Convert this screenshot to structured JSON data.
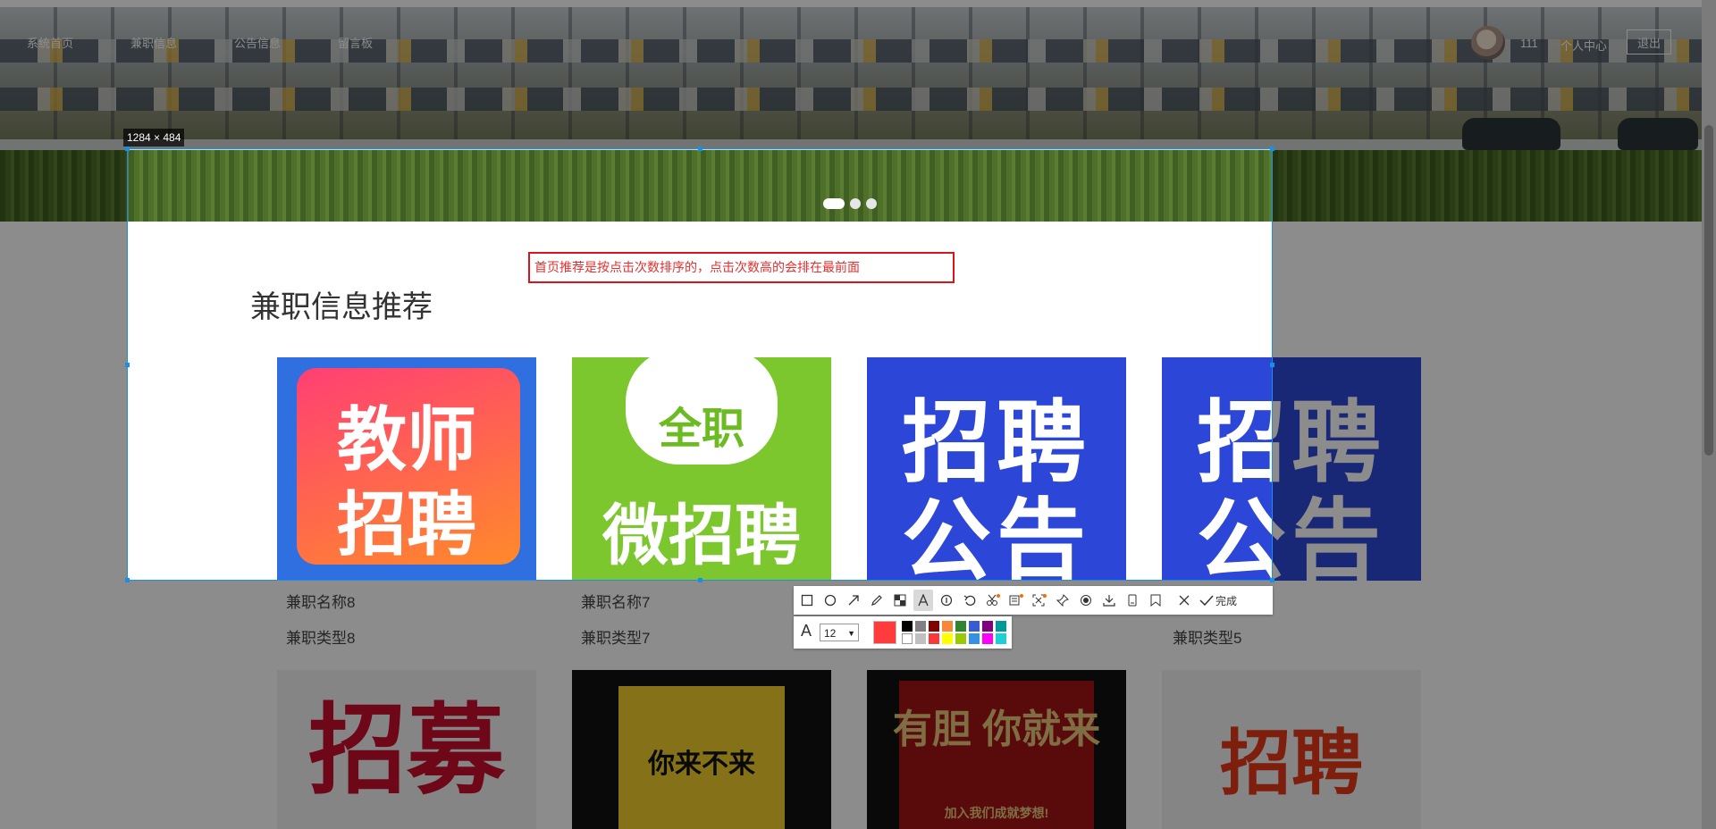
{
  "nav": {
    "items": [
      "系统首页",
      "兼职信息",
      "公告信息",
      "留言板"
    ],
    "user_name": "111",
    "user_center": "个人中心",
    "logout": "退出"
  },
  "carousel": {
    "slide_count": 3,
    "active_index": 0
  },
  "section": {
    "title": "兼职信息推荐"
  },
  "cards": [
    {
      "poster_line1": "教师",
      "poster_line2": "招聘",
      "name": "兼职名称8",
      "type": "兼职类型8"
    },
    {
      "poster_line1": "全职",
      "poster_line2": "微招聘",
      "name": "兼职名称7",
      "type": "兼职类型7"
    },
    {
      "poster_line1": "招聘",
      "poster_line2": "公告",
      "name": "",
      "type": ""
    },
    {
      "poster_line1": "招聘",
      "poster_line2": "公告",
      "name": "",
      "type": "兼职类型5"
    }
  ],
  "cards_row2": [
    {
      "poster_text": "招募"
    },
    {
      "poster_text": "你来不来"
    },
    {
      "poster_text": "有胆 你就来",
      "poster_sub": "加入我们成就梦想!"
    },
    {
      "poster_text": "招聘"
    }
  ],
  "screenshot": {
    "size_label": "1284 × 484",
    "annotation_text": "首页推荐是按点击次数排序的，点击次数高的会排在最前面",
    "font_size": "12",
    "done_label": "完成",
    "current_color": "#ff3b3b",
    "palette": [
      "#000000",
      "#808080",
      "#800000",
      "#f7883a",
      "#308430",
      "#385ad3",
      "#800080",
      "#009999",
      "#ffffff",
      "#c0c0c0",
      "#fb3838",
      "#ffff00",
      "#99cc00",
      "#3890e0",
      "#ff00ff",
      "#1ed0d6"
    ]
  },
  "toolbar_icons": [
    "rectangle-icon",
    "ellipse-icon",
    "arrow-icon",
    "pen-icon",
    "mosaic-icon",
    "text-icon",
    "serial-number-icon",
    "undo-icon",
    "cut-icon",
    "ocr-icon",
    "scroll-capture-icon",
    "pin-icon",
    "record-icon",
    "download-icon",
    "save-icon",
    "bookmark-icon",
    "cancel-icon",
    "done-icon"
  ]
}
